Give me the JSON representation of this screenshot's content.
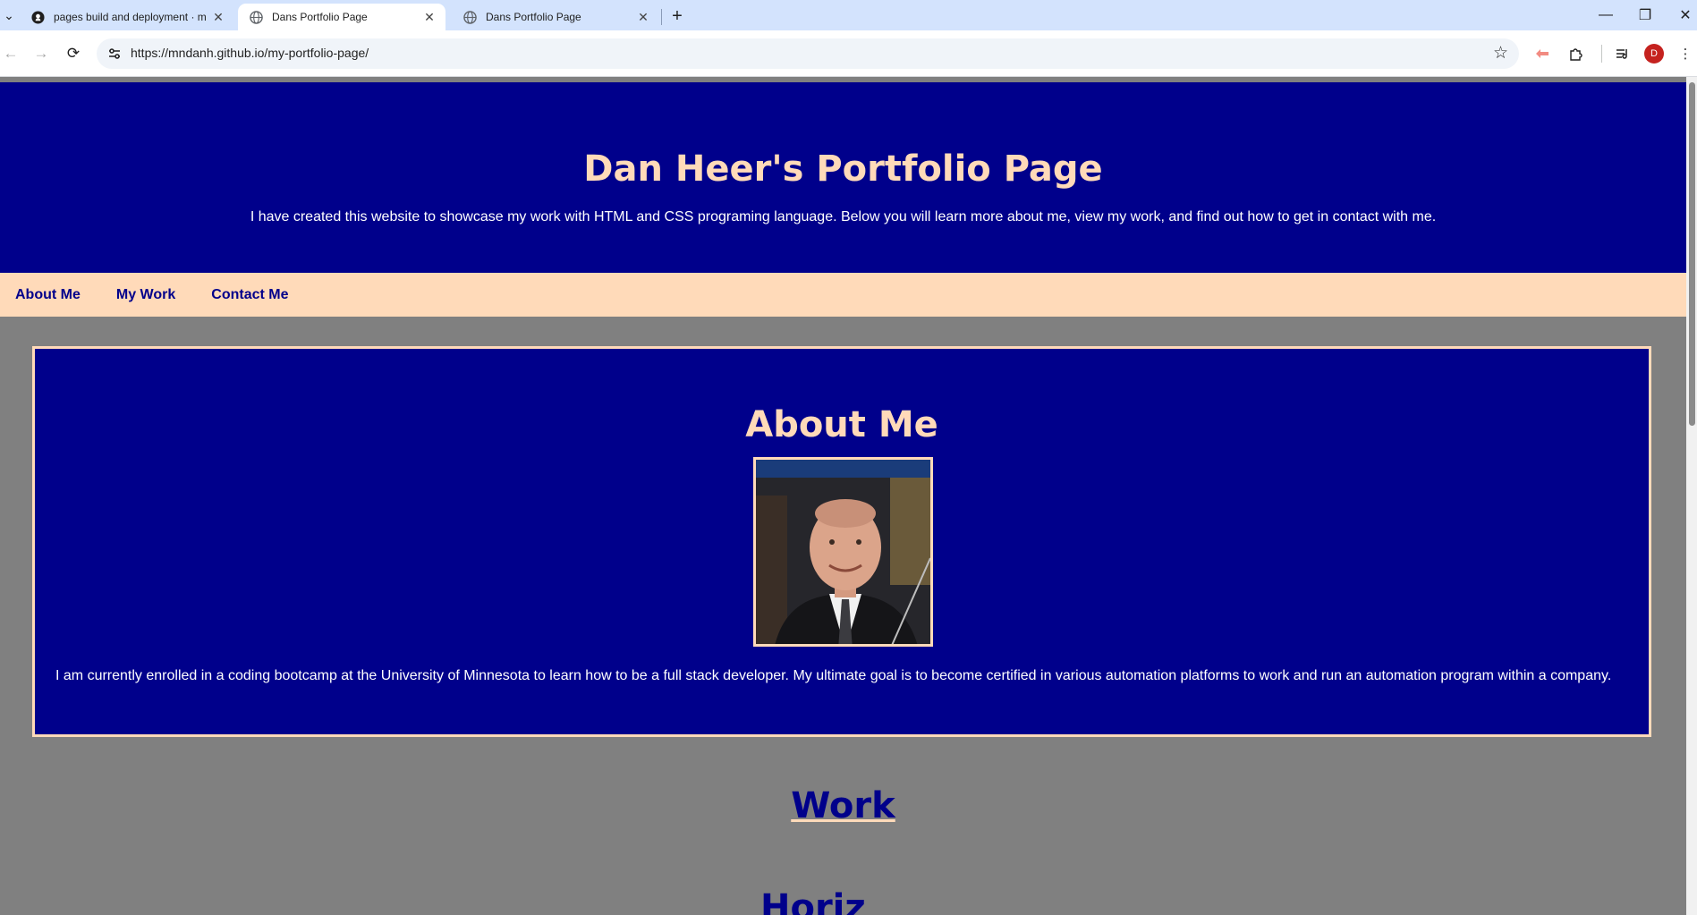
{
  "browser": {
    "tabs": [
      {
        "title": "pages build and deployment · m",
        "active": false,
        "icon": "github-icon"
      },
      {
        "title": "Dans Portfolio Page",
        "active": true,
        "icon": "globe-icon"
      },
      {
        "title": "Dans Portfolio Page",
        "active": false,
        "icon": "globe-icon"
      }
    ],
    "url": "https://mndanh.github.io/my-portfolio-page/",
    "profile_initial": "D"
  },
  "page": {
    "header": {
      "title": "Dan Heer's Portfolio Page",
      "subtitle": "I have created this website to showcase my work with HTML and CSS programing language. Below you will learn more about me, view my work, and find out how to get in contact with me."
    },
    "nav": {
      "items": [
        "About Me",
        "My Work",
        "Contact Me"
      ]
    },
    "about": {
      "heading": "About Me",
      "body": "I am currently enrolled in a coding bootcamp at the University of Minnesota to learn how to be a full stack developer. My ultimate goal is to become certified in various automation platforms to work and run an automation program within a company."
    },
    "work": {
      "heading": "Work",
      "next_heading_partial": "Horiz"
    },
    "colors": {
      "navy": "#00008b",
      "peach": "#ffdab9",
      "page_bg": "#808080",
      "chrome_tabbar": "#d3e3fd"
    }
  }
}
